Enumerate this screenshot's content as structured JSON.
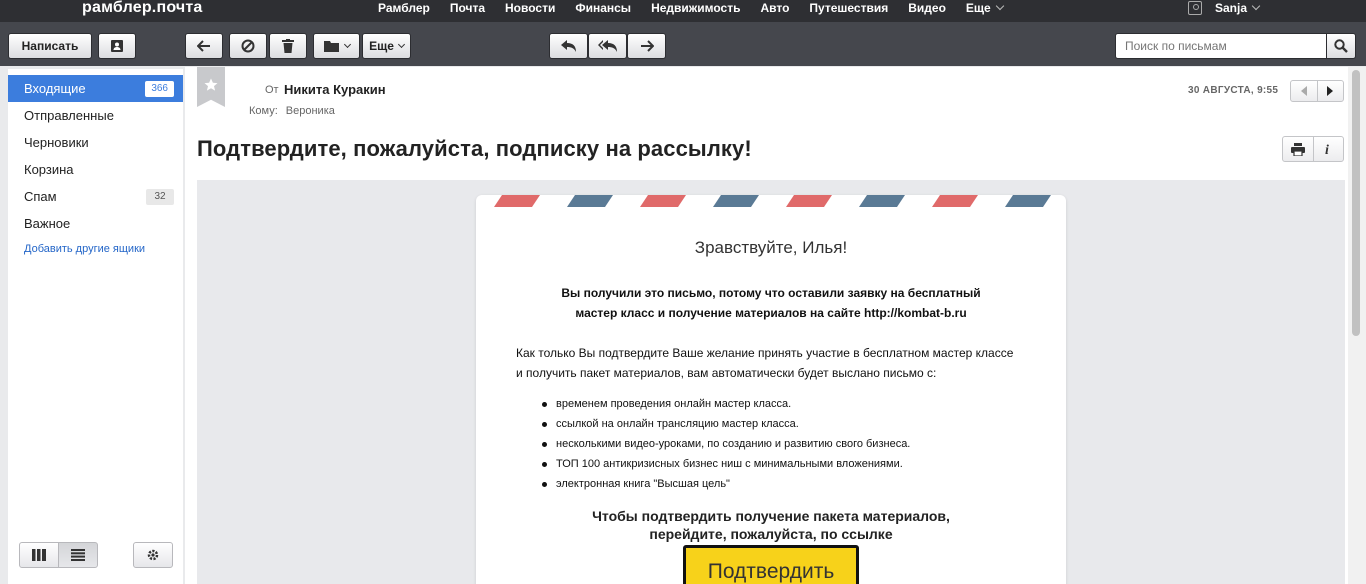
{
  "topbar": {
    "logo": "рамблер.почта",
    "nav": [
      "Рамблер",
      "Почта",
      "Новости",
      "Финансы",
      "Недвижимость",
      "Авто",
      "Путешествия",
      "Видео"
    ],
    "more_label": "Еще",
    "user_name": "Sanja"
  },
  "toolbar": {
    "compose_label": "Написать",
    "more_label": "Еще",
    "search_placeholder": "Поиск по письмам"
  },
  "sidebar": {
    "folders": [
      {
        "label": "Входящие",
        "count": "366",
        "active": true
      },
      {
        "label": "Отправленные",
        "count": ""
      },
      {
        "label": "Черновики",
        "count": ""
      },
      {
        "label": "Корзина",
        "count": ""
      },
      {
        "label": "Спам",
        "count": "32"
      },
      {
        "label": "Важное",
        "count": ""
      }
    ],
    "add_link": "Добавить другие ящики"
  },
  "message": {
    "from_label": "От",
    "from_name": "Никита Куракин",
    "to_label": "Кому:",
    "to_name": "Вероника",
    "date": "30 АВГУСТА, 9:55",
    "subject": "Подтвердите, пожалуйста, подписку на рассылку!"
  },
  "letter": {
    "greeting": "Зравствуйте, Илья!",
    "intro_line1": "Вы получили это письмо, потому что оставили заявку на бесплатный",
    "intro_line2": "мастер класс и получение материалов на сайте http://kombat-b.ru",
    "body_line1": "Как только Вы подтвердите Ваше желание принять участие в бесплатном мастер классе",
    "body_line2": "и получить пакет материалов, вам автоматически будет выслано письмо с:",
    "bullets": [
      "временем проведения онлайн мастер класса.",
      "ссылкой на онлайн трансляцию мастер класса.",
      "несколькими видео-уроками, по созданию и развитию свого бизнеса.",
      "ТОП 100 антикризисных бизнес ниш с минимальными вложениями.",
      "электронная книга \"Высшая цель\""
    ],
    "cta_line1": "Чтобы подтвердить получение пакета материалов,",
    "cta_line2": "перейдите, пожалуйста, по ссылке",
    "confirm_label": "Подтвердить"
  },
  "colors": {
    "topbar": "#2e2f33",
    "toolbar": "#45474d",
    "accent": "#3c7ddd",
    "stripe_red": "#e06a6a",
    "stripe_blue": "#5a7a95",
    "confirm_button": "#f7d21a"
  },
  "icons": [
    "contacts-icon",
    "back-icon",
    "block-icon",
    "trash-icon",
    "folder-icon",
    "reply-icon",
    "reply-all-icon",
    "forward-icon",
    "search-icon",
    "star-icon",
    "prev-icon",
    "next-icon",
    "print-icon",
    "info-icon",
    "three-column-icon",
    "list-view-icon",
    "settings-icon",
    "user-icon"
  ]
}
